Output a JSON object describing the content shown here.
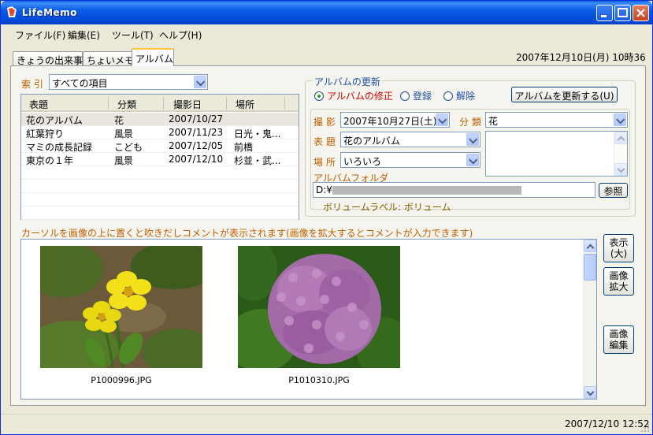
{
  "window": {
    "title": "LifeMemo"
  },
  "menu": [
    "ファイル(F)",
    "編集(E)",
    "ツール(T)",
    "ヘルプ(H)"
  ],
  "tabs": [
    "きょうの出来事",
    "ちょいメモ",
    "アルバム"
  ],
  "active_tab": "アルバム",
  "header_datetime": "2007年12月10日(月) 10時36分",
  "index": {
    "label": "索 引",
    "selected": "すべての項目"
  },
  "album_list": {
    "columns": [
      "表題",
      "分類",
      "撮影日",
      "場所"
    ],
    "rows": [
      [
        "花のアルバム",
        "花",
        "2007/10/27",
        ""
      ],
      [
        "紅葉狩り",
        "風景",
        "2007/11/23",
        "日光・鬼..."
      ],
      [
        "マミの成長記録",
        "こども",
        "2007/12/05",
        "前橋"
      ],
      [
        "東京の１年",
        "風景",
        "2007/12/10",
        "杉並・武..."
      ]
    ],
    "selected_row": 0
  },
  "update": {
    "group_title": "アルバムの更新",
    "radio_modify": "アルバムの修正",
    "radio_register": "登録",
    "radio_release": "解除",
    "update_button": "アルバムを更新する(U)",
    "shoot_label": "撮 影",
    "shoot_date": "2007年10月27日(土)",
    "category_label": "分 類",
    "category_value": "花",
    "title_label": "表 題",
    "title_value": "花のアルバム",
    "place_label": "場 所",
    "place_value": "いろいろ",
    "folder_label": "アルバムフォルダ",
    "folder_path": "D:¥",
    "browse_button": "参照",
    "volume_label": "ボリュームラベル: ボリューム"
  },
  "hint": "カーソルを画像の上に置くと吹きだしコメントが表示されます(画像を拡大するとコメントが入力できます)",
  "images": [
    {
      "file": "P1000996.JPG",
      "subject": "yellow-flower"
    },
    {
      "file": "P1010310.JPG",
      "subject": "purple-hydrangea"
    }
  ],
  "side_buttons": {
    "show": [
      "表示",
      "(大)"
    ],
    "enlarge": [
      "画像",
      "拡大"
    ],
    "edit": [
      "画像",
      "編集"
    ]
  },
  "status_time": "2007/12/10 12:52",
  "colors": {
    "title_blue": "#0a5ce6",
    "accent_orange": "#c06000",
    "radio_red": "#d00000"
  }
}
